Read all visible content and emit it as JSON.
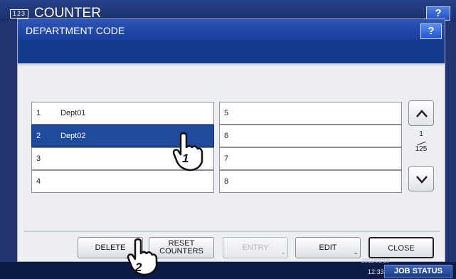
{
  "background": {
    "title": "COUNTER",
    "icon_text": "123",
    "help": "?"
  },
  "dialog": {
    "title": "DEPARTMENT CODE",
    "help": "?"
  },
  "departments_left": [
    {
      "num": "1",
      "name": "Dept01",
      "selected": false
    },
    {
      "num": "2",
      "name": "Dept02",
      "selected": true
    },
    {
      "num": "3",
      "name": "",
      "selected": false
    },
    {
      "num": "4",
      "name": "",
      "selected": false
    }
  ],
  "departments_right": [
    {
      "num": "5",
      "name": ""
    },
    {
      "num": "6",
      "name": ""
    },
    {
      "num": "7",
      "name": ""
    },
    {
      "num": "8",
      "name": ""
    }
  ],
  "pagination": {
    "current": "1",
    "total": "125"
  },
  "buttons": {
    "delete": "DELETE",
    "reset_line1": "RESET",
    "reset_line2": "COUNTERS",
    "entry": "ENTRY",
    "edit": "EDIT",
    "close": "CLOSE"
  },
  "status": {
    "job_status": "JOB STATUS",
    "time": "12:33",
    "date": "2011/03/18"
  },
  "callouts": [
    "1",
    "2"
  ],
  "colors": {
    "title_bar": "#1f4aa8",
    "selected_row": "#1e4b9c",
    "status_bar": "#0d1c47"
  }
}
